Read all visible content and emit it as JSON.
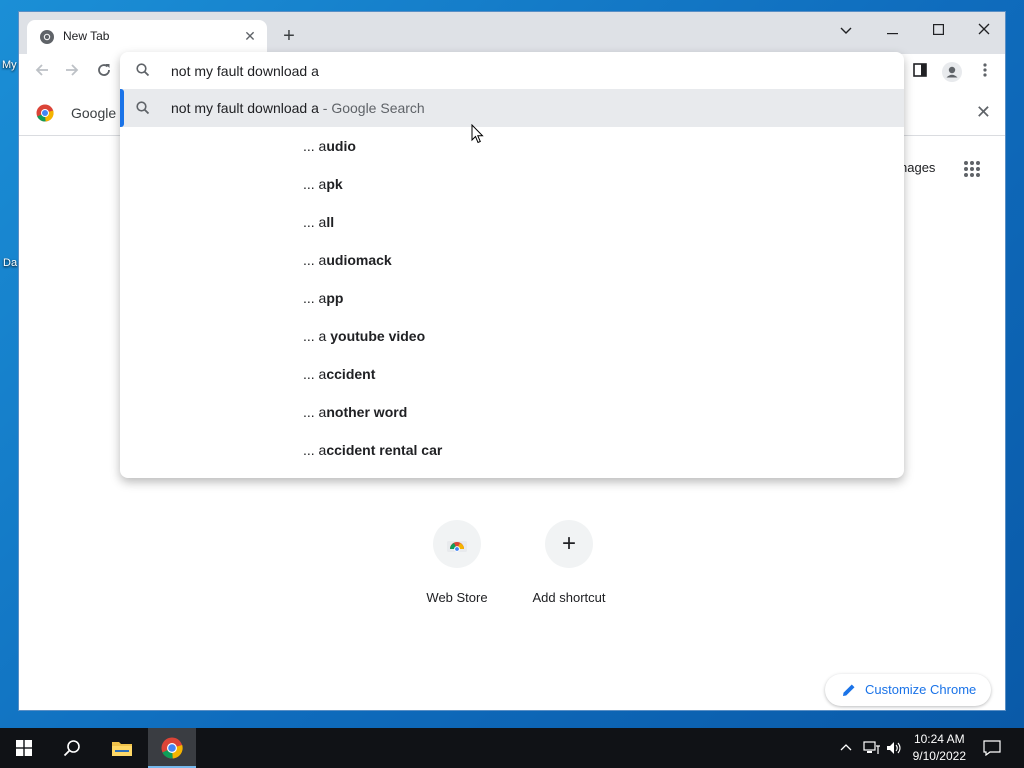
{
  "desktop": {
    "icon_labels": [
      "My",
      "Da"
    ]
  },
  "browser": {
    "tab_title": "New Tab",
    "bookmark_label": "Google C",
    "window_controls": [
      "tab-search",
      "minimize",
      "maximize",
      "close"
    ]
  },
  "omnibox": {
    "input_value": "not my fault download a",
    "top_suggestion": {
      "query": "not my fault download a",
      "suffix": "Google Search"
    },
    "tail_prefix": "... a",
    "tail_suggestions": [
      {
        "pre": "... a",
        "bold": "udio"
      },
      {
        "pre": "... a",
        "bold": "pk"
      },
      {
        "pre": "... a",
        "bold": "ll"
      },
      {
        "pre": "... a",
        "bold": "udiomack"
      },
      {
        "pre": "... a",
        "bold": "pp"
      },
      {
        "pre": "... a ",
        "bold": "youtube video"
      },
      {
        "pre": "... a",
        "bold": "ccident"
      },
      {
        "pre": "... a",
        "bold": "nother word"
      },
      {
        "pre": "... a",
        "bold": "ccident rental car"
      }
    ]
  },
  "page": {
    "images_link": "Images",
    "images_visible": "nages",
    "shortcuts": [
      {
        "label": "Web Store",
        "icon": "web-store-icon"
      },
      {
        "label": "Add shortcut",
        "icon": "plus-icon"
      }
    ],
    "customize_label": "Customize Chrome"
  },
  "taskbar": {
    "time": "10:24 AM",
    "date": "9/10/2022"
  },
  "colors": {
    "accent": "#1a73e8",
    "selected_row": "#e8eaed",
    "taskbar": "#101216"
  }
}
